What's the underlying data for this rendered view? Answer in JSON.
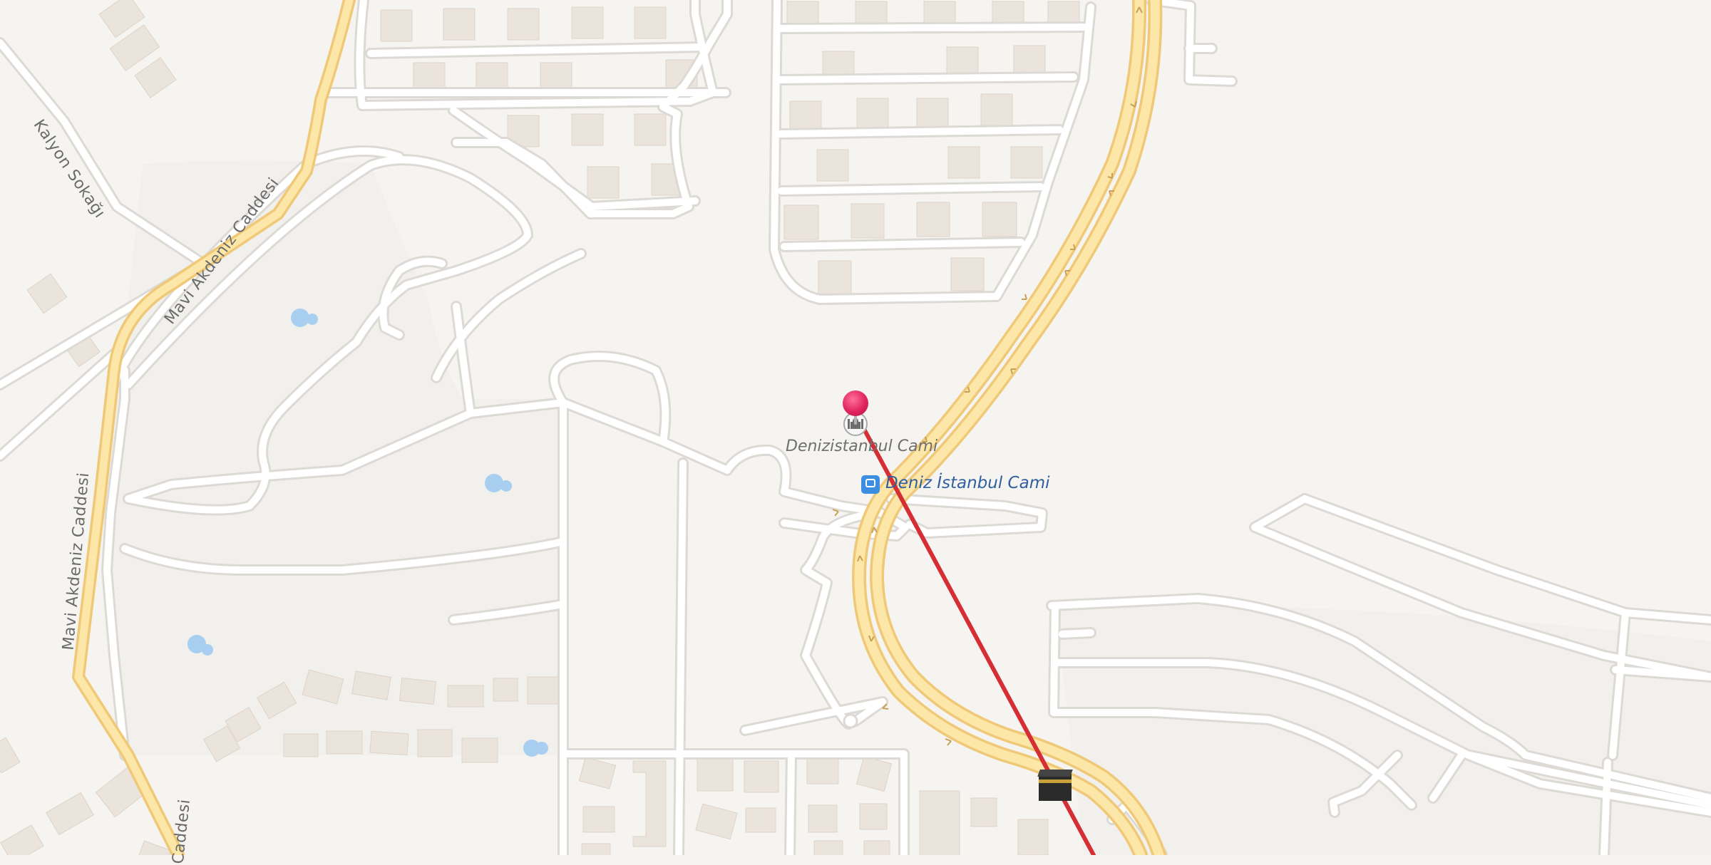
{
  "map": {
    "colors": {
      "land": "#f6f4f1",
      "block": "#f2f0ec",
      "street": "#ffffff",
      "street_casing": "#dddad5",
      "arterial_fill": "#fce7a8",
      "arterial_casing": "#efc978",
      "building": "#ebe4dd",
      "water": "#a8cff0",
      "route_line": "#d62e35",
      "pin": "#e0245e",
      "transit": "#3c8ee0"
    },
    "street_labels": {
      "kalyon": "Kalyon Sokağı",
      "mavi_upper": "Mavi Akdeniz Caddesi",
      "mavi_lower": "Mavi Akdeniz Caddesi",
      "mavi_bottom": "Caddesi"
    },
    "pois": {
      "mosque_label": "Denizistanbul Cami",
      "mosque_icon": "mosque-icon",
      "kaaba_icon": "kaaba-icon",
      "pin_icon": "location-pin-icon"
    },
    "transit": {
      "stop_label": "Deniz İstanbul Cami",
      "stop_icon": "bus-stop-icon"
    }
  }
}
